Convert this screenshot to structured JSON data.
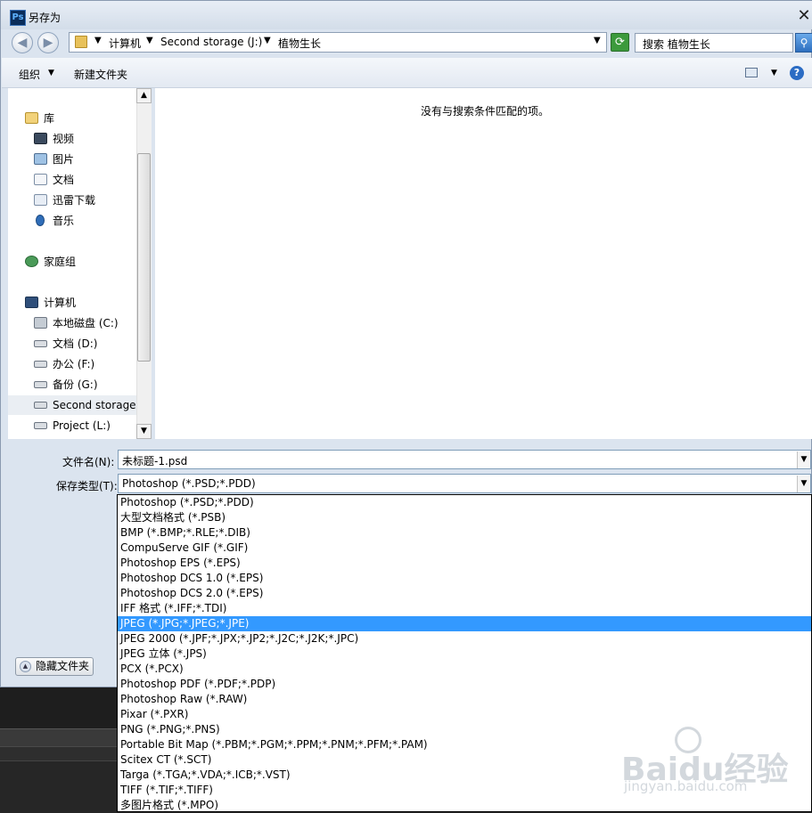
{
  "window": {
    "title": "另存为",
    "close_glyph": "✕"
  },
  "address": {
    "back_glyph": "◀",
    "forward_glyph": "▶",
    "crumbs": [
      "计算机",
      "Second storage (J:)",
      "植物生长"
    ],
    "search_value": "搜索 植物生长",
    "refresh_glyph": "⟳",
    "search_glyph": "⚲"
  },
  "toolbar": {
    "organize": "组织",
    "new_folder": "新建文件夹",
    "help": "?"
  },
  "nav": {
    "items": [
      {
        "label": "库",
        "icon": "library-icon"
      },
      {
        "label": "视频",
        "icon": "video-icon"
      },
      {
        "label": "图片",
        "icon": "picture-icon"
      },
      {
        "label": "文档",
        "icon": "document-icon"
      },
      {
        "label": "迅雷下载",
        "icon": "download-icon"
      },
      {
        "label": "音乐",
        "icon": "music-icon"
      },
      {
        "label": "家庭组",
        "icon": "homegroup-icon"
      },
      {
        "label": "计算机",
        "icon": "computer-icon"
      },
      {
        "label": "本地磁盘 (C:)",
        "icon": "system-drive-icon"
      },
      {
        "label": "文档 (D:)",
        "icon": "drive-icon"
      },
      {
        "label": "办公 (F:)",
        "icon": "drive-icon"
      },
      {
        "label": "备份 (G:)",
        "icon": "drive-icon"
      },
      {
        "label": "Second storage",
        "icon": "drive-icon"
      },
      {
        "label": "Project (L:)",
        "icon": "drive-icon"
      }
    ],
    "selected": "Second storage"
  },
  "main": {
    "empty_message": "没有与搜索条件匹配的项。"
  },
  "form": {
    "filename_label": "文件名(N):",
    "filename_value": "未标题-1.psd",
    "filetype_label": "保存类型(T):",
    "filetype_value": "Photoshop (*.PSD;*.PDD)"
  },
  "filetype_options": [
    "Photoshop (*.PSD;*.PDD)",
    "大型文档格式 (*.PSB)",
    "BMP (*.BMP;*.RLE;*.DIB)",
    "CompuServe GIF (*.GIF)",
    "Photoshop EPS (*.EPS)",
    "Photoshop DCS 1.0 (*.EPS)",
    "Photoshop DCS 2.0 (*.EPS)",
    "IFF 格式 (*.IFF;*.TDI)",
    "JPEG (*.JPG;*.JPEG;*.JPE)",
    "JPEG 2000 (*.JPF;*.JPX;*.JP2;*.J2C;*.J2K;*.JPC)",
    "JPEG 立体 (*.JPS)",
    "PCX (*.PCX)",
    "Photoshop PDF (*.PDF;*.PDP)",
    "Photoshop Raw (*.RAW)",
    "Pixar (*.PXR)",
    "PNG (*.PNG;*.PNS)",
    "Portable Bit Map (*.PBM;*.PGM;*.PPM;*.PNM;*.PFM;*.PAM)",
    "Scitex CT (*.SCT)",
    "Targa (*.TGA;*.VDA;*.ICB;*.VST)",
    "TIFF (*.TIF;*.TIFF)",
    "多图片格式 (*.MPO)"
  ],
  "selected_option": "JPEG (*.JPG;*.JPEG;*.JPE)",
  "hide_folders_label": "隐藏文件夹",
  "watermark": {
    "logo": "Baidu经验",
    "url": "jingyan.baidu.com"
  },
  "colors": {
    "selection": "#3399ff",
    "dialog_bg": "#dbe4ef"
  }
}
